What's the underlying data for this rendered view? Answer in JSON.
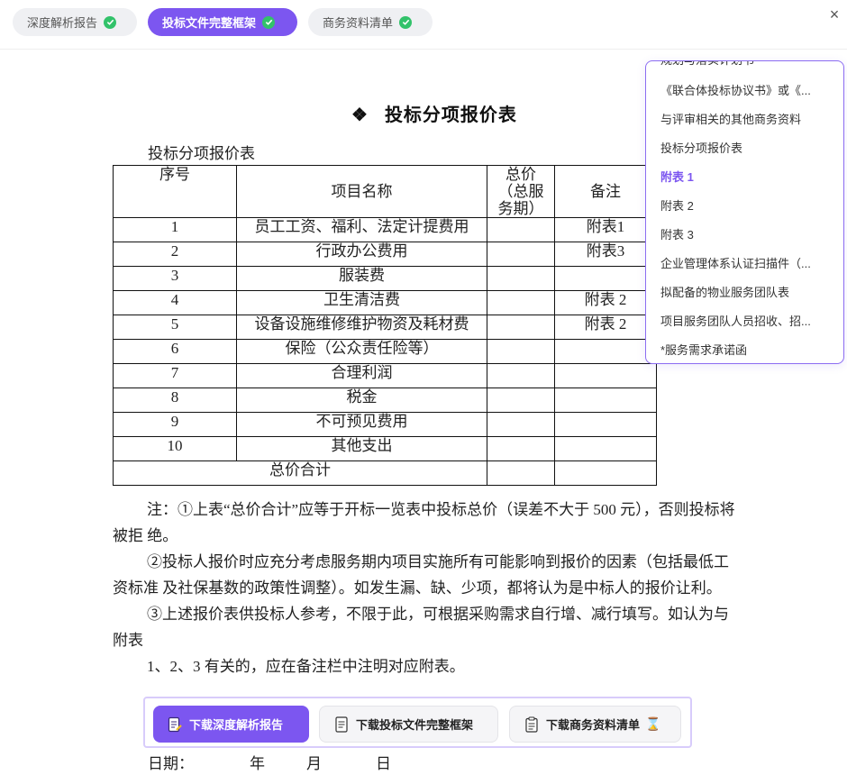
{
  "tabs": [
    {
      "label": "深度解析报告",
      "done": true
    },
    {
      "label": "投标文件完整框架",
      "done": true,
      "active": true
    },
    {
      "label": "商务资料清单",
      "done": true
    }
  ],
  "close_label": "×",
  "document": {
    "heading_symbol": "❖",
    "heading": "投标分项报价表",
    "table_caption": "投标分项报价表",
    "table": {
      "headers": {
        "no": "序号",
        "name": "项目名称",
        "total_lines": [
          "总价",
          "（总服",
          "务期）"
        ],
        "note": "备注"
      },
      "rows": [
        {
          "no": "1",
          "name": "员工工资、福利、法定计提费用",
          "total": "",
          "note": "附表1"
        },
        {
          "no": "2",
          "name": "行政办公费用",
          "total": "",
          "note": "附表3"
        },
        {
          "no": "3",
          "name": "服装费",
          "total": "",
          "note": ""
        },
        {
          "no": "4",
          "name": "卫生清洁费",
          "total": "",
          "note": "附表 2"
        },
        {
          "no": "5",
          "name": "设备设施维修维护物资及耗材费",
          "total": "",
          "note": "附表 2"
        },
        {
          "no": "6",
          "name": "保险（公众责任险等）",
          "total": "",
          "note": ""
        },
        {
          "no": "7",
          "name": "合理利润",
          "total": "",
          "note": ""
        },
        {
          "no": "8",
          "name": "税金",
          "total": "",
          "note": ""
        },
        {
          "no": "9",
          "name": "不可预见费用",
          "total": "",
          "note": ""
        },
        {
          "no": "10",
          "name": "其他支出",
          "total": "",
          "note": ""
        }
      ],
      "total_row_label": "总价合计"
    },
    "notes": [
      "注：①上表“总价合计”应等于开标一览表中投标总价（误差不大于 500 元），否则投标将被拒 绝。",
      "②投标人报价时应充分考虑服务期内项目实施所有可能影响到报价的因素（包括最低工资标准 及社保基数的政策性调整）。如发生漏、缺、少项，都将认为是中标人的报价让利。",
      "③上述报价表供投标人参考，不限于此，可根据采购需求自行增、减行填写。如认为与附表",
      "1、2、3 有关的，应在备注栏中注明对应附表。"
    ],
    "date_line": {
      "label": "日期：",
      "year": "年",
      "month": "月",
      "day": "日"
    }
  },
  "outline": {
    "items": [
      {
        "label": "规划与落实计划书"
      },
      {
        "label": "《联合体投标协议书》或《..."
      },
      {
        "label": "与评审相关的其他商务资料"
      },
      {
        "label": "投标分项报价表"
      },
      {
        "label": "附表 1",
        "active": true
      },
      {
        "label": "附表 2"
      },
      {
        "label": "附表 3"
      },
      {
        "label": "企业管理体系认证扫描件（..."
      },
      {
        "label": "拟配备的物业服务团队表"
      },
      {
        "label": "项目服务团队人员招收、招..."
      },
      {
        "label": "*服务需求承诺函"
      }
    ]
  },
  "download_bar": {
    "buttons": [
      {
        "label": "下载深度解析报告",
        "primary": true
      },
      {
        "label": "下载投标文件完整框架"
      },
      {
        "label": "下载商务资料清单",
        "pending": true
      }
    ]
  },
  "colors": {
    "accent": "#7c56f0",
    "success": "#32c26a",
    "pending": "#d08a10"
  }
}
